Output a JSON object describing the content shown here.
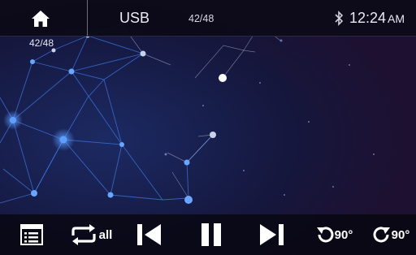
{
  "header": {
    "source_label": "USB",
    "track_counter": "42/48",
    "time": "12:24",
    "ampm": "AM"
  },
  "overlay": {
    "track_counter": "42/48"
  },
  "controls": {
    "repeat_label": "all",
    "rotate_left_label": "90°",
    "rotate_right_label": "90°"
  },
  "icons": [
    "home-icon",
    "bluetooth-icon",
    "playlist-icon",
    "repeat-icon",
    "previous-icon",
    "pause-icon",
    "next-icon",
    "rotate-left-icon",
    "rotate-right-icon"
  ],
  "colors": {
    "background": "#120f2a",
    "bar": "#0c0a18",
    "accent": "#3b82f6"
  }
}
